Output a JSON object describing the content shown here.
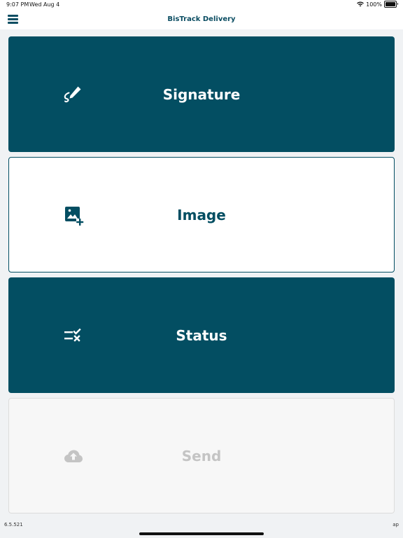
{
  "status_bar": {
    "time": "9:07 PM",
    "date": "Wed Aug 4",
    "battery": "100%",
    "battery_level": 1.0
  },
  "nav": {
    "title": "BisTrack Delivery",
    "menu_icon": "hamburger-menu-icon"
  },
  "tiles": [
    {
      "label": "Signature",
      "icon": "signature-pen-icon",
      "style": "dark",
      "enabled": true
    },
    {
      "label": "Image",
      "icon": "add-image-icon",
      "style": "light",
      "enabled": true
    },
    {
      "label": "Status",
      "icon": "status-checklist-icon",
      "style": "dark",
      "enabled": true
    },
    {
      "label": "Send",
      "icon": "cloud-upload-icon",
      "style": "disabled",
      "enabled": false
    }
  ],
  "footer": {
    "version": "6.5.521",
    "user": "ap"
  },
  "colors": {
    "primary": "#034e62",
    "disabled_text": "#c4c4c4",
    "background": "#f0f2f4"
  }
}
